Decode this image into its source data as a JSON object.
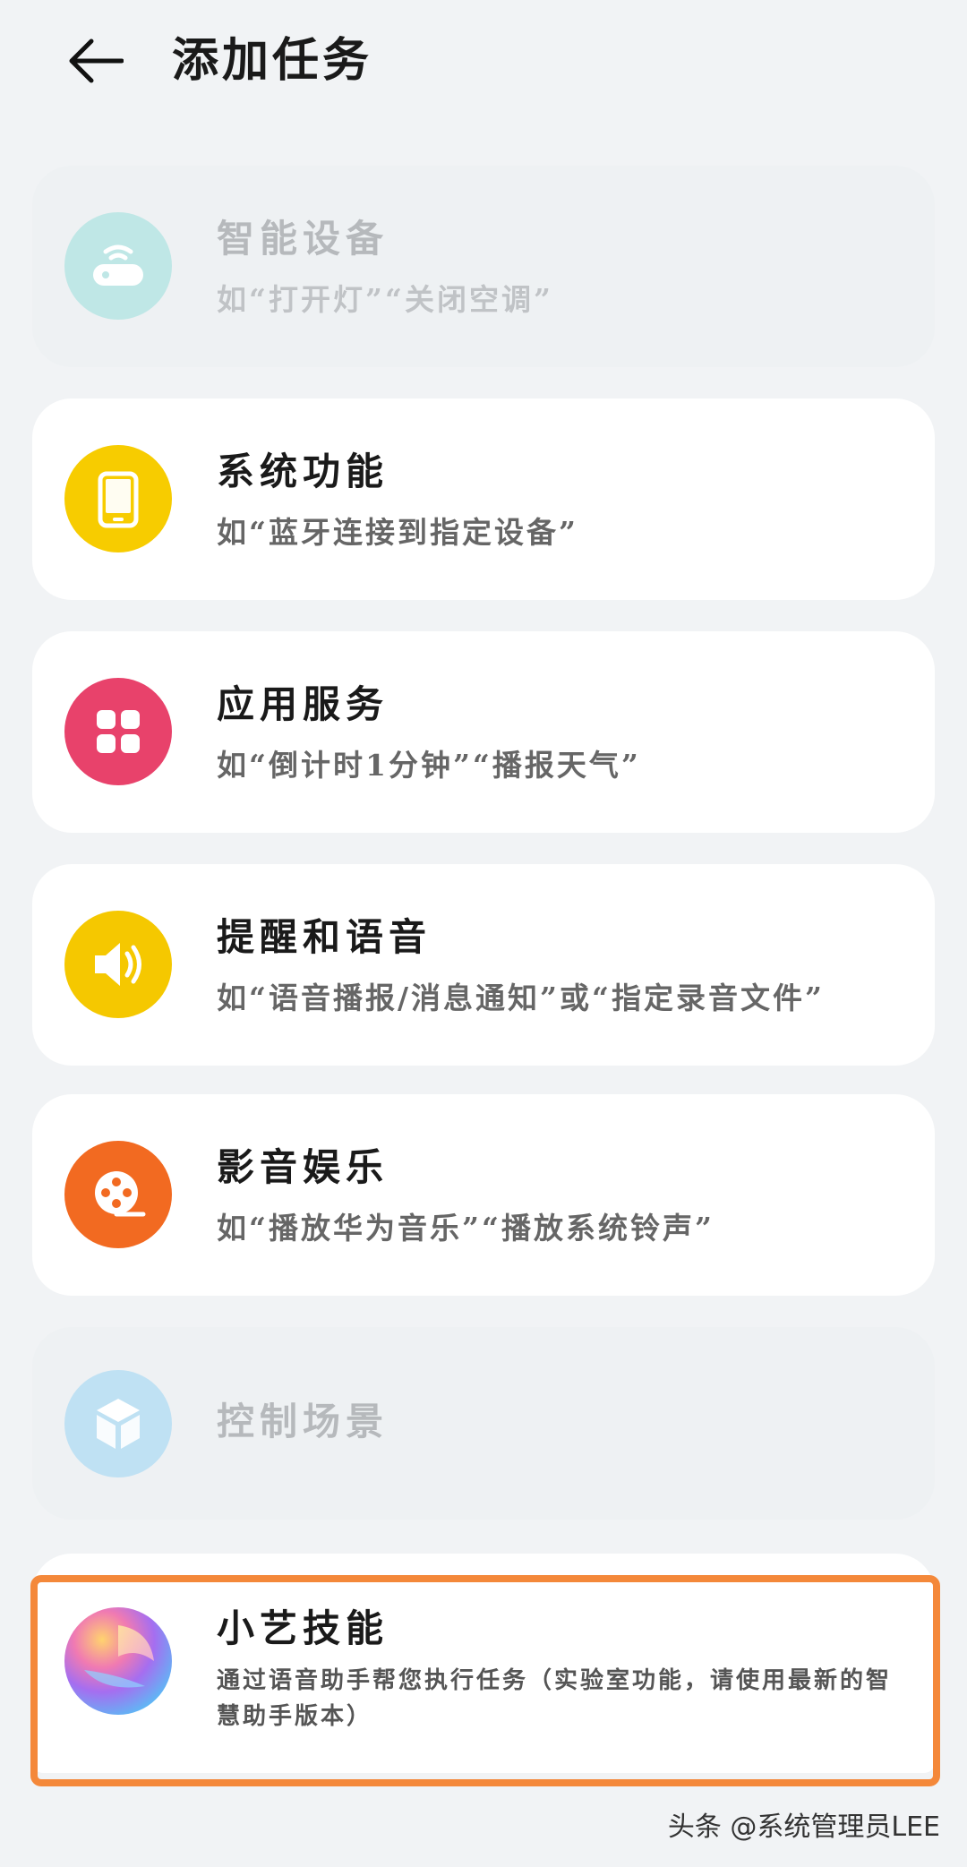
{
  "header": {
    "title": "添加任务"
  },
  "items": [
    {
      "title": "智能设备",
      "subtitle": "如“打开灯”“关闭空调”",
      "icon": "wifi-router-icon",
      "color": "#bfe7e6",
      "enabled": false
    },
    {
      "title": "系统功能",
      "subtitle": "如“蓝牙连接到指定设备”",
      "icon": "phone-icon",
      "color": "#f7cc00",
      "enabled": true
    },
    {
      "title": "应用服务",
      "subtitle": "如“倒计时1分钟”“播报天气”",
      "icon": "apps-grid-icon",
      "color": "#e8426b",
      "enabled": true
    },
    {
      "title": "提醒和语音",
      "subtitle": "如“语音播报/消息通知”或“指定录音文件”",
      "icon": "speaker-icon",
      "color": "#f5c800",
      "enabled": true
    },
    {
      "title": "影音娱乐",
      "subtitle": "如“播放华为音乐”“播放系统铃声”",
      "icon": "film-reel-icon",
      "color": "#f26a21",
      "enabled": true
    },
    {
      "title": "控制场景",
      "subtitle": "",
      "icon": "cube-icon",
      "color": "#bfe1f3",
      "enabled": false
    },
    {
      "title": "小艺技能",
      "subtitle": "通过语音助手帮您执行任务（实验室功能，请使用最新的智慧助手版本）",
      "icon": "xiaoyi-orb-icon",
      "color": "#f4883a",
      "enabled": true
    }
  ],
  "watermark": "头条 @系统管理员LEE"
}
